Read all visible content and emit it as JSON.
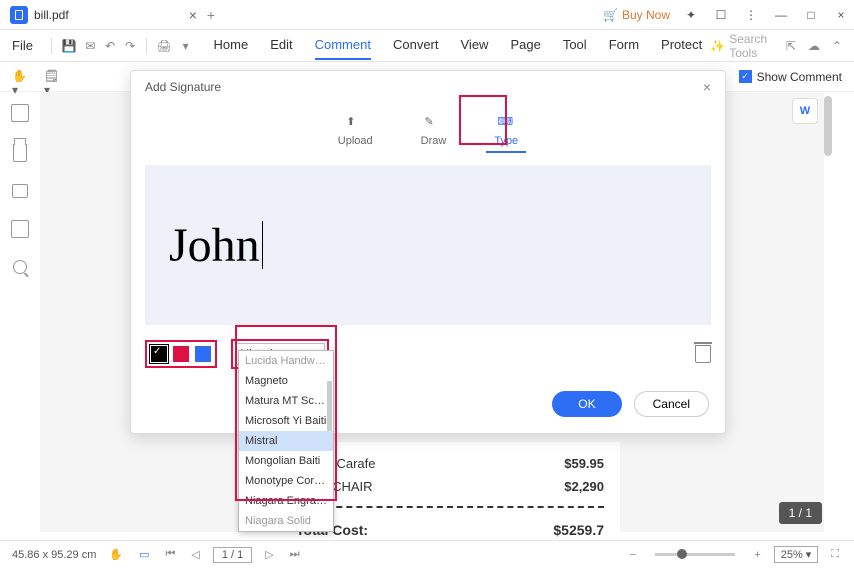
{
  "titlebar": {
    "filename": "bill.pdf",
    "buy_now": "Buy Now"
  },
  "menubar": {
    "file": "File",
    "tabs": [
      "Home",
      "Edit",
      "Comment",
      "Convert",
      "View",
      "Page",
      "Tool",
      "Form",
      "Protect"
    ],
    "active_index": 2,
    "search_placeholder": "Search Tools"
  },
  "toolbar": {
    "show_comment": "Show Comment"
  },
  "dialog": {
    "title": "Add Signature",
    "modes": {
      "upload": "Upload",
      "draw": "Draw",
      "type": "Type"
    },
    "active_mode": "type",
    "signature_text": "John",
    "font_selected": "Mistral",
    "buttons": {
      "ok": "OK",
      "cancel": "Cancel"
    },
    "colors": {
      "black": "#000000",
      "red": "#dd1144",
      "blue": "#2d6ef5"
    }
  },
  "font_options": [
    "Lucida Handwrit…",
    "Magneto",
    "Matura MT Scrip…",
    "Microsoft Yi Baiti",
    "Mistral",
    "Mongolian Baiti",
    "Monotype Corsiva",
    "Niagara Engraved",
    "Niagara Solid"
  ],
  "font_selected_index": 4,
  "document": {
    "rows": [
      {
        "name": "eather Carafe",
        "price": "$59.95"
      },
      {
        "name": "NING CHAIR",
        "price": "$2,290"
      }
    ],
    "total_label": "Total Cost:",
    "total_value": "$5259.7"
  },
  "float_badge": "W",
  "page_badge": "1 / 1",
  "statusbar": {
    "dims": "45.86 x 95.29 cm",
    "page": "1 / 1",
    "zoom": "25%"
  }
}
